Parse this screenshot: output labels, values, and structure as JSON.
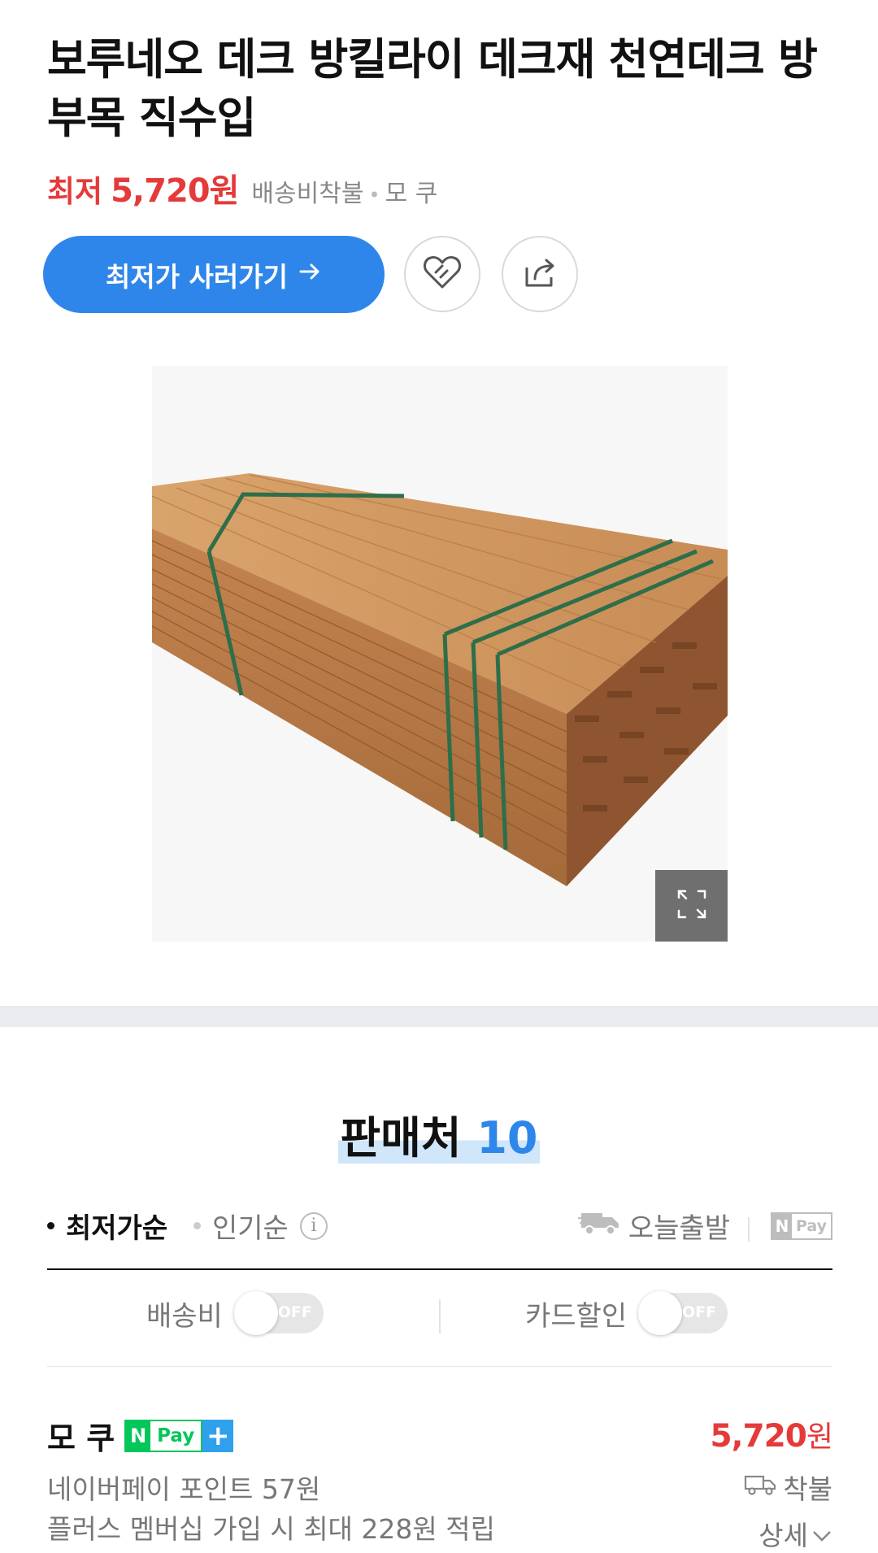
{
  "product": {
    "title": "보루네오 데크 방킬라이 데크재 천연데크 방부목 직수입",
    "price_label": "최저",
    "price": "5,720원",
    "shipping": "배송비착불",
    "seller": "모 쿠"
  },
  "actions": {
    "buy_label": "최저가 사러가기",
    "wishlist_icon": "heart-icon",
    "share_icon": "share-icon"
  },
  "image": {
    "alt": "목재 데크재 묶음",
    "expand_icon": "expand-icon"
  },
  "sellers": {
    "title": "판매처",
    "count": "10",
    "sort_options": [
      {
        "label": "최저가순",
        "active": true
      },
      {
        "label": "인기순",
        "active": false
      }
    ],
    "info_icon_text": "i",
    "today_ship_label": "오늘출발",
    "npay_badge": {
      "n": "N",
      "pay": "Pay"
    },
    "filters": [
      {
        "label": "배송비",
        "state": "OFF"
      },
      {
        "label": "카드할인",
        "state": "OFF"
      }
    ],
    "items": [
      {
        "name": "모 쿠",
        "price_value": "5,720",
        "price_unit": "원",
        "point_text": "네이버페이 포인트 57원",
        "membership_text": "플러스 멤버십 가입 시 최대 228원 적립",
        "shipping": "착불",
        "detail": "상세",
        "npay": {
          "n": "N",
          "pay": "Pay",
          "plus": "+"
        }
      }
    ]
  },
  "colors": {
    "accent": "#2f86ea",
    "price_red": "#e53a3a",
    "npay_green": "#03c75a"
  }
}
